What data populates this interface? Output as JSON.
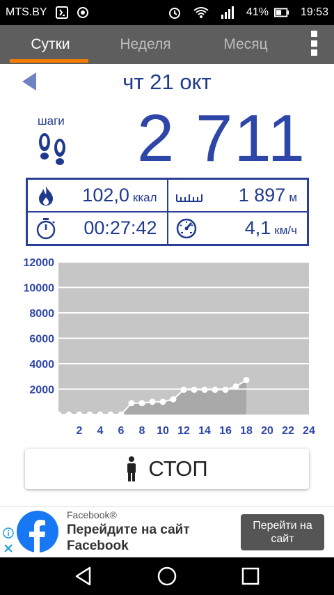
{
  "status_bar": {
    "carrier": "MTS.BY",
    "battery": "41%",
    "time": "19:53"
  },
  "tabs": [
    {
      "label": "Сутки",
      "active": true
    },
    {
      "label": "Неделя",
      "active": false
    },
    {
      "label": "Месяц",
      "active": false
    }
  ],
  "day": {
    "date": "чт 21 окт",
    "steps_label": "шаги",
    "steps": "2 711"
  },
  "stats": {
    "calories": {
      "value": "102,0",
      "unit": "ккал"
    },
    "distance": {
      "value": "1 897",
      "unit": "м"
    },
    "duration": {
      "value": "00:27:42"
    },
    "speed": {
      "value": "4,1",
      "unit": "км/ч"
    }
  },
  "chart_data": {
    "type": "area",
    "x": [
      0,
      1,
      2,
      3,
      4,
      5,
      6,
      7,
      8,
      9,
      10,
      11,
      12,
      13,
      14,
      15,
      16,
      17,
      18
    ],
    "y": [
      0,
      0,
      0,
      0,
      0,
      0,
      0,
      900,
      900,
      1000,
      1000,
      1200,
      1950,
      1950,
      1950,
      1950,
      1950,
      2200,
      2711
    ],
    "xticks": [
      "2",
      "4",
      "6",
      "8",
      "10",
      "12",
      "14",
      "16",
      "18",
      "20",
      "22",
      "24"
    ],
    "yticks": [
      "2000",
      "4000",
      "6000",
      "8000",
      "10000",
      "12000"
    ],
    "xlim": [
      0,
      24
    ],
    "ylim": [
      0,
      12000
    ],
    "grid": true,
    "colors": {
      "plot_bg": "#c6c6c6",
      "fill": "#a9a9a9",
      "tick_label": "#2e46a7",
      "line": "#ffffff"
    }
  },
  "stop_button": {
    "label": "СТОП"
  },
  "ad": {
    "brand": "Facebook®",
    "title": "Перейдите на сайт Facebook",
    "cta": "Перейти на сайт"
  },
  "colors": {
    "accent": "#f57c00",
    "primary_blue": "#2e46a7",
    "tab_bg": "#5e5e5e"
  }
}
